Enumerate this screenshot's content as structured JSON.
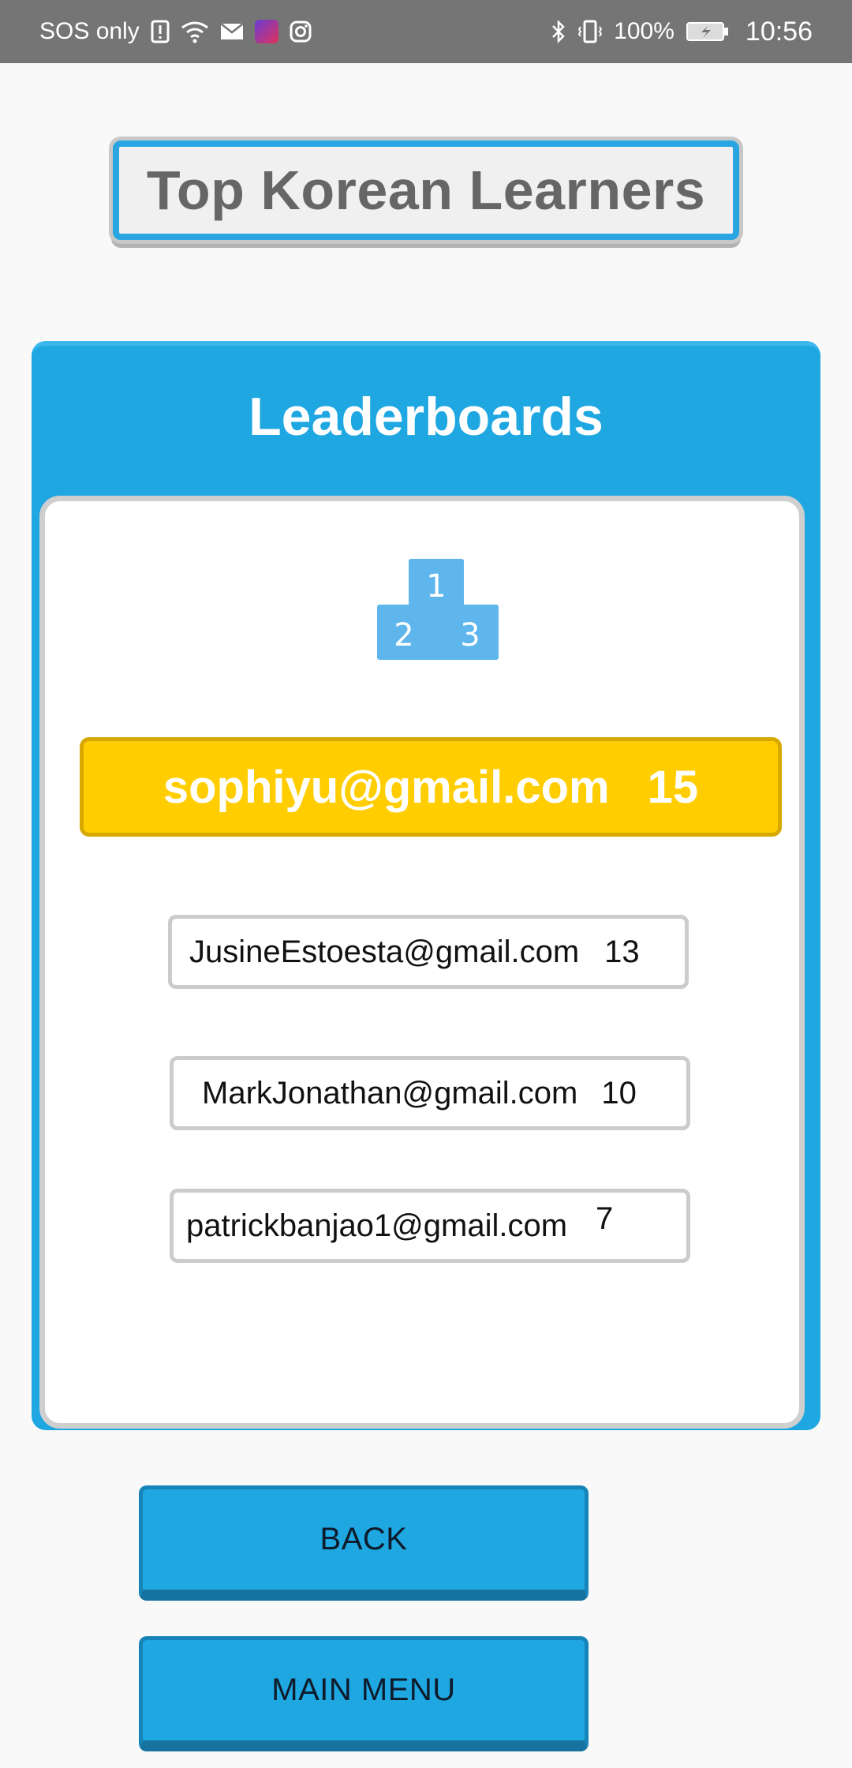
{
  "status_bar": {
    "carrier": "SOS only",
    "battery": "100%",
    "time": "10:56",
    "icons": [
      "alert-icon",
      "wifi-icon",
      "mail-icon",
      "app-icon",
      "instagram-icon",
      "bluetooth-icon",
      "vibrate-icon",
      "battery-charging-icon"
    ]
  },
  "title": "Top Korean Learners",
  "leaderboard": {
    "header": "Leaderboards",
    "icon": "podium-icon",
    "top": {
      "email": "sophiyu@gmail.com",
      "score": "15"
    },
    "entries": [
      {
        "email": "JusineEstoesta@gmail.com",
        "score": "13"
      },
      {
        "email": "MarkJonathan@gmail.com",
        "score": "10"
      },
      {
        "email": "patrickbanjao1@gmail.com",
        "score": "7"
      }
    ]
  },
  "buttons": {
    "back": "BACK",
    "main_menu": "MAIN MENU"
  },
  "colors": {
    "accent": "#1ea7e1",
    "gold": "#ffcd00",
    "status_bar": "#757575"
  }
}
